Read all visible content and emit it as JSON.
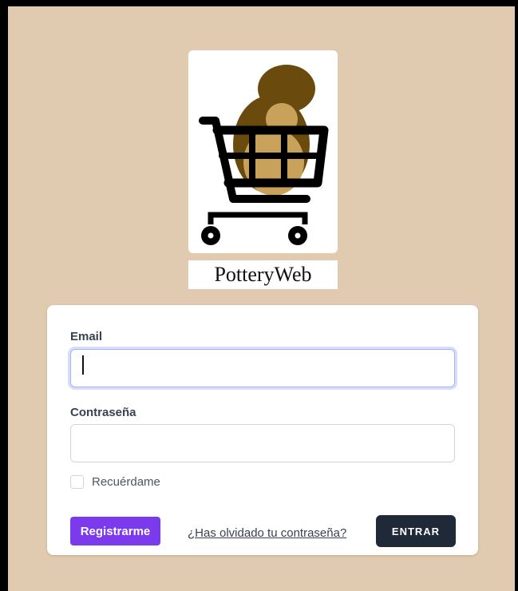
{
  "brand": {
    "name": "PotteryWeb"
  },
  "logo": {
    "icon": "shopping-cart-with-pottery-icon"
  },
  "form": {
    "email_label": "Email",
    "email_value": "",
    "password_label": "Contraseña",
    "password_value": "",
    "remember_label": "Recuérdame",
    "remember_checked": false,
    "register_label": "Registrarme",
    "forgot_label": "¿Has olvidado tu contraseña?",
    "login_label": "ENTRAR"
  },
  "colors": {
    "background": "#e0cbb0",
    "register_button": "#7c3aed",
    "login_button": "#1f2937",
    "focus_ring": "#a5b4fc"
  }
}
